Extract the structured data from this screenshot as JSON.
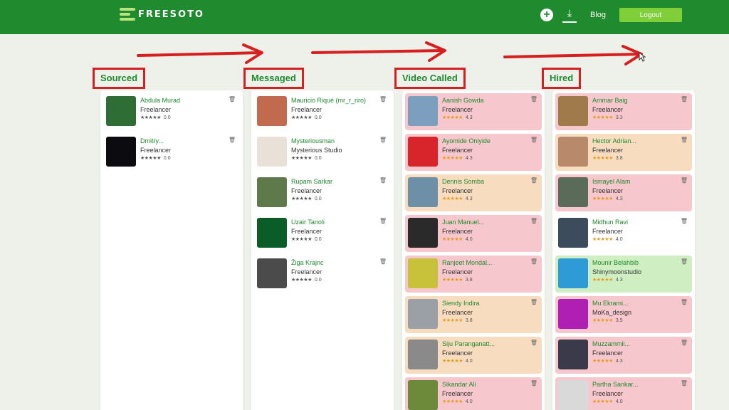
{
  "app": {
    "name": "FREESOTO"
  },
  "nav": {
    "blog": "Blog",
    "logout": "Logout",
    "add_icon": "plus-circle-icon",
    "download_icon": "download-icon"
  },
  "columns": [
    {
      "title": "Sourced",
      "cards": [
        {
          "name": "Abdula Murad",
          "role": "Freelancer",
          "stars": "★★★★★",
          "rating": "0.0",
          "tint": "plain",
          "avatar_color": "#2e6d34"
        },
        {
          "name": "Dmitry...",
          "role": "Freelancer",
          "stars": "★★★★★",
          "rating": "0.0",
          "tint": "plain",
          "avatar_color": "#0c0c10"
        }
      ]
    },
    {
      "title": "Messaged",
      "cards": [
        {
          "name": "Mauricio Riqué (mr_r_riro)",
          "role": "Freelancer",
          "stars": "★★★★★",
          "rating": "0.0",
          "tint": "plain",
          "avatar_color": "#c26a4e"
        },
        {
          "name": "Mysteriousman",
          "role": "Mysterious Studio",
          "stars": "★★★★★",
          "rating": "0.0",
          "tint": "plain",
          "avatar_color": "#e9e1d8"
        },
        {
          "name": "Rupam Sarkar",
          "role": "Freelancer",
          "stars": "★★★★★",
          "rating": "0.0",
          "tint": "plain",
          "avatar_color": "#5f7a4a"
        },
        {
          "name": "Uzair Tanoli",
          "role": "Freelancer",
          "stars": "★★★★★",
          "rating": "0.0",
          "tint": "plain",
          "avatar_color": "#0b5d27"
        },
        {
          "name": "Žiga Krajnc",
          "role": "Freelancer",
          "stars": "★★★★★",
          "rating": "0.0",
          "tint": "plain",
          "avatar_color": "#4b4b4b"
        }
      ]
    },
    {
      "title": "Video Called",
      "cards": [
        {
          "name": "Aanish Gowda",
          "role": "Freelancer",
          "stars": "★★★★★",
          "rating": "4.3",
          "tint": "pink",
          "avatar_color": "#7d9fbf"
        },
        {
          "name": "Ayomide Oniyide",
          "role": "Freelancer",
          "stars": "★★★★★",
          "rating": "4.3",
          "tint": "pink",
          "avatar_color": "#d8242b"
        },
        {
          "name": "Dennis Somba",
          "role": "Freelancer",
          "stars": "★★★★★",
          "rating": "4.3",
          "tint": "peach",
          "avatar_color": "#6e8fa8"
        },
        {
          "name": "Juan Manuel...",
          "role": "Freelancer",
          "stars": "★★★★★",
          "rating": "4.0",
          "tint": "pink",
          "avatar_color": "#2a2a2a"
        },
        {
          "name": "Ranjeet Mondal...",
          "role": "Freelancer",
          "stars": "★★★★★",
          "rating": "3.8",
          "tint": "pink",
          "avatar_color": "#c8c13a"
        },
        {
          "name": "Siendy Indira",
          "role": "Freelancer",
          "stars": "★★★★★",
          "rating": "3.8",
          "tint": "peach",
          "avatar_color": "#9aa0a6"
        },
        {
          "name": "Siju Paranganatt...",
          "role": "Freelancer",
          "stars": "★★★★★",
          "rating": "4.0",
          "tint": "peach",
          "avatar_color": "#8a8a8a"
        },
        {
          "name": "Sikandar Ali",
          "role": "Freelancer",
          "stars": "★★★★★",
          "rating": "4.0",
          "tint": "pink",
          "avatar_color": "#6c8a3a"
        }
      ]
    },
    {
      "title": "Hired",
      "cards": [
        {
          "name": "Ammar Baig",
          "role": "Freelancer",
          "stars": "★★★★★",
          "rating": "3.3",
          "tint": "pink",
          "avatar_color": "#a07a4a"
        },
        {
          "name": "Hector Adrian...",
          "role": "Freelancer",
          "stars": "★★★★★",
          "rating": "3.8",
          "tint": "peach",
          "avatar_color": "#b8896a"
        },
        {
          "name": "Ismayel Alam",
          "role": "Freelancer",
          "stars": "★★★★★",
          "rating": "4.3",
          "tint": "pink",
          "avatar_color": "#5b6b5a"
        },
        {
          "name": "Midhun Ravi",
          "role": "Freelancer",
          "stars": "★★★★★",
          "rating": "4.0",
          "tint": "plain",
          "avatar_color": "#3d4c5c"
        },
        {
          "name": "Mounir Belahbib",
          "role": "Shinymoonstudio",
          "stars": "★★★★★",
          "rating": "4.3",
          "tint": "green",
          "avatar_color": "#2f9bd6"
        },
        {
          "name": "Mu Ekrami...",
          "role": "MoKa_design",
          "stars": "★★★★★",
          "rating": "3.5",
          "tint": "pink",
          "avatar_color": "#b01fb4"
        },
        {
          "name": "Muzzammil...",
          "role": "Freelancer",
          "stars": "★★★★★",
          "rating": "4.3",
          "tint": "pink",
          "avatar_color": "#3a3a4a"
        },
        {
          "name": "Partha Sankar...",
          "role": "Freelancer",
          "stars": "★★★★★",
          "rating": "4.0",
          "tint": "pink",
          "avatar_color": "#d9d9d9"
        }
      ]
    }
  ],
  "colors": {
    "brand": "#1f8a2e",
    "accent": "#7fcf3a",
    "highlight": "#d61f1f",
    "star": "#e89a1d"
  },
  "icons": {
    "trash": "trash-icon",
    "logo": "freesoto-logo-icon"
  }
}
